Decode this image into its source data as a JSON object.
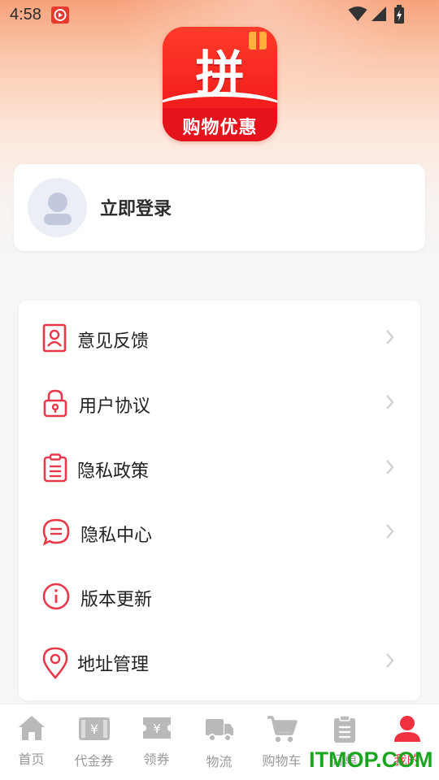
{
  "status_bar": {
    "time": "4:58",
    "icons": [
      "notification-app-icon",
      "wifi-icon",
      "signal-icon",
      "battery-icon"
    ]
  },
  "app_logo": {
    "glyph": "拼",
    "text": "购物优惠"
  },
  "login": {
    "label": "立即登录"
  },
  "menu": {
    "items": [
      {
        "label": "意见反馈",
        "icon": "feedback-icon",
        "has_arrow": true
      },
      {
        "label": "用户协议",
        "icon": "lock-icon",
        "has_arrow": true
      },
      {
        "label": "隐私政策",
        "icon": "clipboard-icon",
        "has_arrow": true
      },
      {
        "label": "隐私中心",
        "icon": "chat-bubble-icon",
        "has_arrow": true
      },
      {
        "label": "版本更新",
        "icon": "info-icon",
        "has_arrow": false
      },
      {
        "label": "地址管理",
        "icon": "location-pin-icon",
        "has_arrow": true
      }
    ]
  },
  "tabbar": {
    "items": [
      {
        "label": "首页",
        "icon": "home-icon"
      },
      {
        "label": "代金券",
        "icon": "voucher-icon"
      },
      {
        "label": "领券",
        "icon": "coupon-icon"
      },
      {
        "label": "物流",
        "icon": "truck-icon"
      },
      {
        "label": "购物车",
        "icon": "cart-icon"
      },
      {
        "label": "订单",
        "icon": "order-icon"
      },
      {
        "label": "我的",
        "icon": "profile-icon"
      }
    ],
    "active_index": 6
  },
  "watermark": "ITMOP.COM",
  "colors": {
    "accent": "#f0313f",
    "icon_red": "#e8394a",
    "tab_inactive": "#9a9a9a",
    "watermark": "#19a51f"
  }
}
